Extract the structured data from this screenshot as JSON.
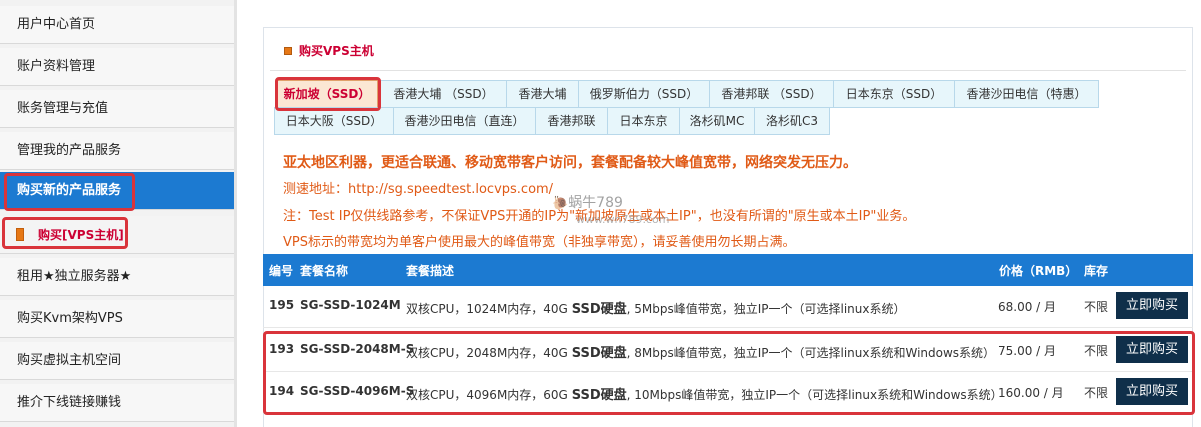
{
  "sidebar": {
    "items": [
      {
        "label": "用户中心首页"
      },
      {
        "label": "账户资料管理"
      },
      {
        "label": "账务管理与充值"
      },
      {
        "label": "管理我的产品服务"
      },
      {
        "label": "购买新的产品服务"
      },
      {
        "label": "购买[VPS主机]"
      },
      {
        "label": "租用★独立服务器★"
      },
      {
        "label": "购买Kvm架构VPS"
      },
      {
        "label": "购买虚拟主机空间"
      },
      {
        "label": "推介下线链接赚钱"
      }
    ]
  },
  "panel": {
    "title": "购买VPS主机"
  },
  "tabs": [
    {
      "label": "新加坡（SSD）"
    },
    {
      "label": "香港大埔 （SSD）"
    },
    {
      "label": "香港大埔"
    },
    {
      "label": "俄罗斯伯力（SSD）"
    },
    {
      "label": "香港邦联 （SSD）"
    },
    {
      "label": "日本东京（SSD）"
    },
    {
      "label": "香港沙田电信（特惠）"
    },
    {
      "label": "日本大阪（SSD）"
    },
    {
      "label": "香港沙田电信（直连）"
    },
    {
      "label": "香港邦联"
    },
    {
      "label": "日本东京"
    },
    {
      "label": "洛杉矶MC"
    },
    {
      "label": "洛杉矶C3"
    }
  ],
  "info": {
    "headline": "亚太地区利器，更适合联通、移动宽带客户访问，套餐配备较大峰值宽带，网络突发无压力。",
    "speedtest": "测速地址：http://sg.speedtest.locvps.com/",
    "note": "注：Test IP仅供线路参考，不保证VPS开通的IP为\"新加坡原生或本土IP\"，也没有所谓的\"原生或本土IP\"业务。",
    "bandwidth": "VPS标示的带宽均为单客户使用最大的峰值带宽（非独享带宽），请妥善使用勿长期占满。"
  },
  "watermark": {
    "name": "蜗牛789",
    "url": "www.wn789.com"
  },
  "table": {
    "headers": {
      "id": "编号",
      "name": "套餐名称",
      "desc": "套餐描述",
      "price": "价格（RMB）",
      "stock": "库存"
    },
    "rows": [
      {
        "id": "195",
        "name": "SG-SSD-1024M",
        "desc_a": "双核CPU，1024M内存，40G ",
        "desc_b": "SSD硬盘",
        "desc_c": ", 5Mbps峰值带宽，独立IP一个（可选择linux系统）",
        "price": "68.00 / 月",
        "stock": "不限",
        "button": "立即购买"
      },
      {
        "id": "193",
        "name": "SG-SSD-2048M-S",
        "desc_a": "双核CPU，2048M内存，40G ",
        "desc_b": "SSD硬盘",
        "desc_c": ", 8Mbps峰值带宽，独立IP一个（可选择linux系统和Windows系统）",
        "price": "75.00 / 月",
        "stock": "不限",
        "button": "立即购买"
      },
      {
        "id": "194",
        "name": "SG-SSD-4096M-S",
        "desc_a": "双核CPU，4096M内存，60G ",
        "desc_b": "SSD硬盘",
        "desc_c": ", 10Mbps峰值带宽，独立IP一个（可选择linux系统和Windows系统）",
        "price": "160.00 / 月",
        "stock": "不限",
        "button": "立即购买"
      }
    ]
  },
  "colors": {
    "accent_blue": "#1c7ad1",
    "highlight_red": "#d9343b",
    "text_orange": "#e05a16",
    "button_navy": "#0f2f4a"
  }
}
